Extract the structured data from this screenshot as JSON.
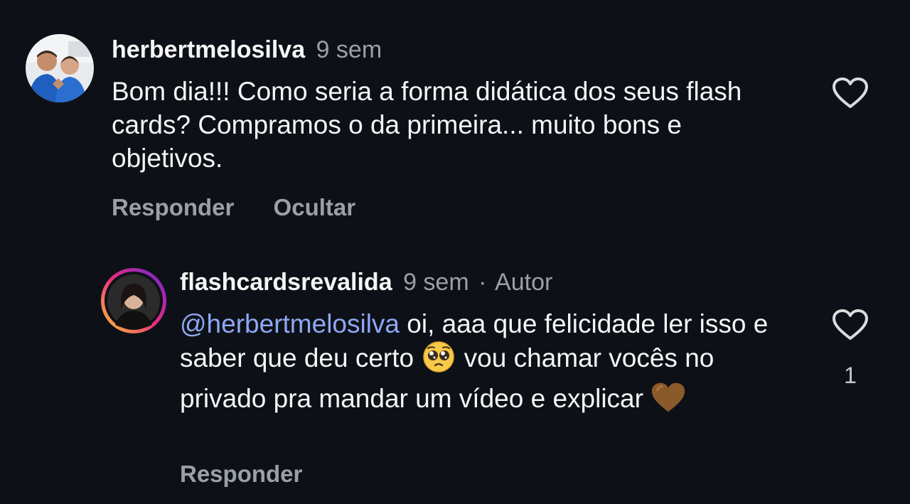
{
  "comments": [
    {
      "username": "herbertmelosilva",
      "time": "9 sem",
      "body": "Bom dia!!! Como seria a forma didática dos seus flash cards? Compramos o da primeira... muito bons e objetivos.",
      "actions": {
        "reply": "Responder",
        "hide": "Ocultar"
      },
      "avatar_icon": "profile-photo-couple",
      "like_icon": "heart-outline-icon"
    },
    {
      "username": "flashcardsrevalida",
      "time": "9 sem",
      "separator": "·",
      "author_tag": "Autor",
      "mention": "@herbertmelosilva",
      "body_part1": " oi, aaa que felicidade ler isso e saber que deu certo ",
      "emoji1": "pleading-face-emoji",
      "body_part2": " vou chamar vocês no privado pra mandar um vídeo e explicar ",
      "emoji2": "brown-heart-emoji",
      "actions": {
        "reply": "Responder"
      },
      "like_count": "1",
      "avatar_icon": "profile-photo-story-ring",
      "like_icon": "heart-outline-icon"
    }
  ],
  "colors": {
    "background": "#0d1117",
    "text": "#f5f5f5",
    "muted": "#9aa0a6",
    "mention": "#8ea8f5",
    "story_ring_start": "#f9ce34",
    "story_ring_mid": "#ee2a7b",
    "story_ring_end": "#6228d7"
  }
}
